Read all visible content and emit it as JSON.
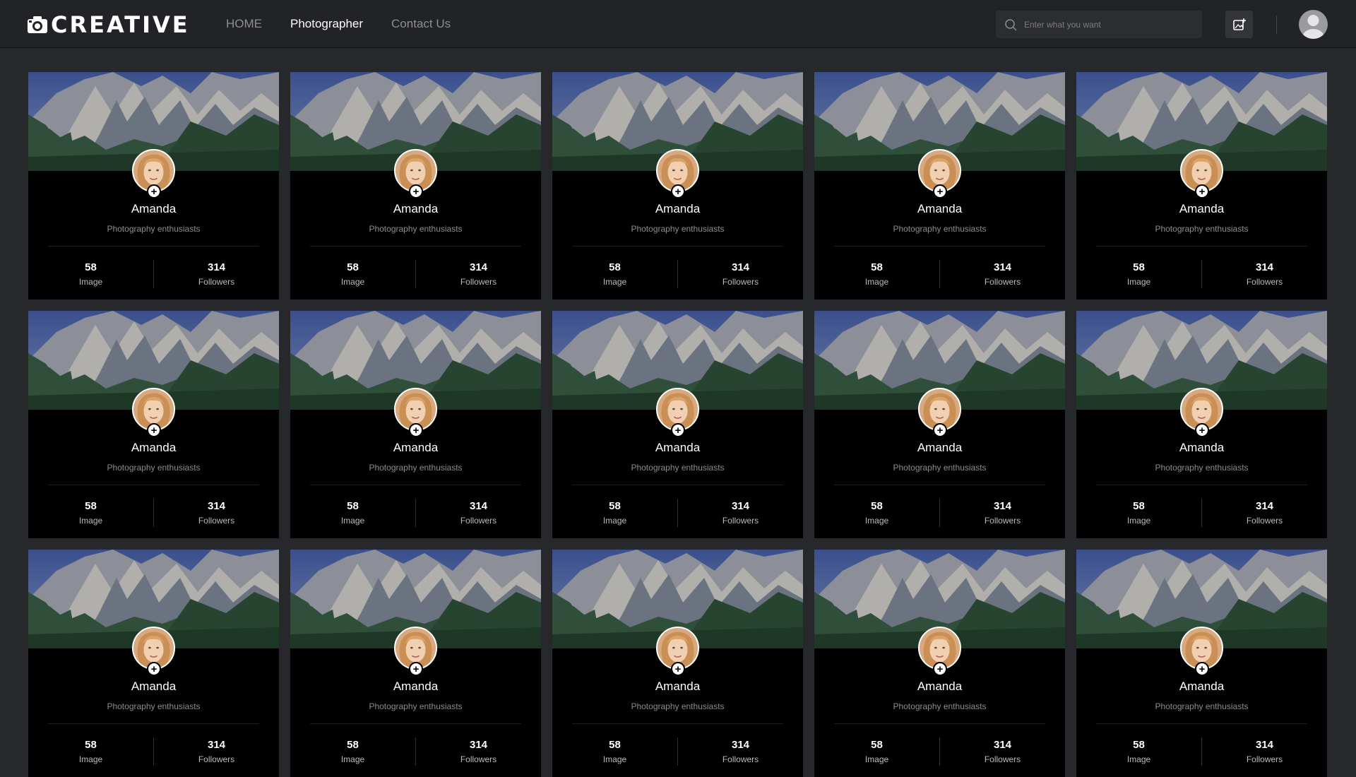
{
  "app": {
    "logo_text": "CREATIVE"
  },
  "nav": {
    "items": [
      {
        "label": "HOME",
        "active": false
      },
      {
        "label": "Photographer",
        "active": true
      },
      {
        "label": "Contact Us",
        "active": false
      }
    ]
  },
  "search": {
    "placeholder": "Enter what you want",
    "icon": "search-icon"
  },
  "header_actions": {
    "upload_icon": "image-upload-icon",
    "avatar_icon": "user-avatar-icon"
  },
  "colors": {
    "background": "#27282c",
    "header": "#222327",
    "card": "#000000",
    "nav_inactive": "#8d8e93",
    "nav_active": "#ffffff"
  },
  "cards": [
    {
      "name": "Amanda",
      "subtitle": "Photography enthusiasts",
      "images_value": "58",
      "images_label": "Image",
      "followers_value": "314",
      "followers_label": "Followers"
    },
    {
      "name": "Amanda",
      "subtitle": "Photography enthusiasts",
      "images_value": "58",
      "images_label": "Image",
      "followers_value": "314",
      "followers_label": "Followers"
    },
    {
      "name": "Amanda",
      "subtitle": "Photography enthusiasts",
      "images_value": "58",
      "images_label": "Image",
      "followers_value": "314",
      "followers_label": "Followers"
    },
    {
      "name": "Amanda",
      "subtitle": "Photography enthusiasts",
      "images_value": "58",
      "images_label": "Image",
      "followers_value": "314",
      "followers_label": "Followers"
    },
    {
      "name": "Amanda",
      "subtitle": "Photography enthusiasts",
      "images_value": "58",
      "images_label": "Image",
      "followers_value": "314",
      "followers_label": "Followers"
    },
    {
      "name": "Amanda",
      "subtitle": "Photography enthusiasts",
      "images_value": "58",
      "images_label": "Image",
      "followers_value": "314",
      "followers_label": "Followers"
    },
    {
      "name": "Amanda",
      "subtitle": "Photography enthusiasts",
      "images_value": "58",
      "images_label": "Image",
      "followers_value": "314",
      "followers_label": "Followers"
    },
    {
      "name": "Amanda",
      "subtitle": "Photography enthusiasts",
      "images_value": "58",
      "images_label": "Image",
      "followers_value": "314",
      "followers_label": "Followers"
    },
    {
      "name": "Amanda",
      "subtitle": "Photography enthusiasts",
      "images_value": "58",
      "images_label": "Image",
      "followers_value": "314",
      "followers_label": "Followers"
    },
    {
      "name": "Amanda",
      "subtitle": "Photography enthusiasts",
      "images_value": "58",
      "images_label": "Image",
      "followers_value": "314",
      "followers_label": "Followers"
    },
    {
      "name": "Amanda",
      "subtitle": "Photography enthusiasts",
      "images_value": "58",
      "images_label": "Image",
      "followers_value": "314",
      "followers_label": "Followers"
    },
    {
      "name": "Amanda",
      "subtitle": "Photography enthusiasts",
      "images_value": "58",
      "images_label": "Image",
      "followers_value": "314",
      "followers_label": "Followers"
    },
    {
      "name": "Amanda",
      "subtitle": "Photography enthusiasts",
      "images_value": "58",
      "images_label": "Image",
      "followers_value": "314",
      "followers_label": "Followers"
    },
    {
      "name": "Amanda",
      "subtitle": "Photography enthusiasts",
      "images_value": "58",
      "images_label": "Image",
      "followers_value": "314",
      "followers_label": "Followers"
    },
    {
      "name": "Amanda",
      "subtitle": "Photography enthusiasts",
      "images_value": "58",
      "images_label": "Image",
      "followers_value": "314",
      "followers_label": "Followers"
    }
  ]
}
